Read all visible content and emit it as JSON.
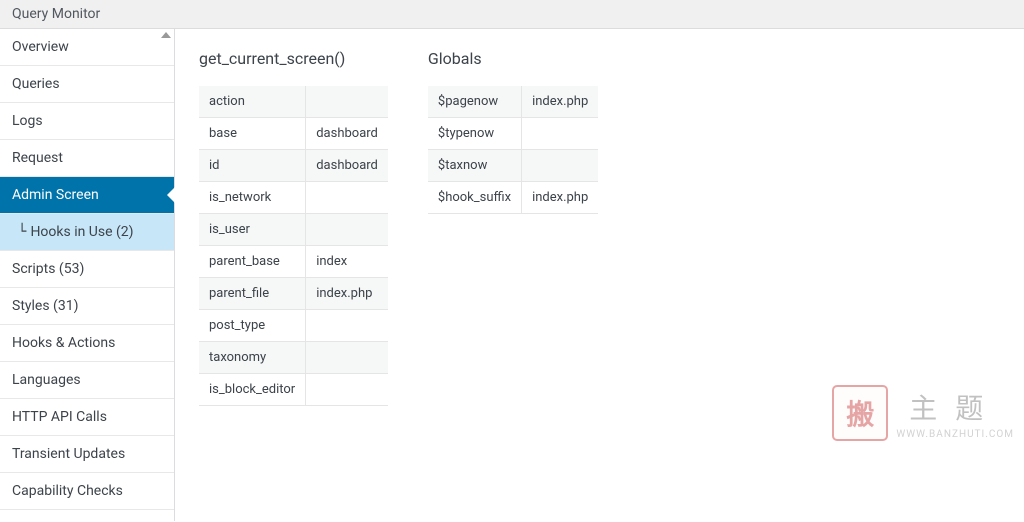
{
  "header": {
    "title": "Query Monitor"
  },
  "sidebar": {
    "items": [
      {
        "label": "Overview"
      },
      {
        "label": "Queries"
      },
      {
        "label": "Logs"
      },
      {
        "label": "Request"
      },
      {
        "label": "Admin Screen"
      },
      {
        "label": "Hooks in Use (2)"
      },
      {
        "label": "Scripts (53)"
      },
      {
        "label": "Styles (31)"
      },
      {
        "label": "Hooks & Actions"
      },
      {
        "label": "Languages"
      },
      {
        "label": "HTTP API Calls"
      },
      {
        "label": "Transient Updates"
      },
      {
        "label": "Capability Checks"
      }
    ]
  },
  "screen_section": {
    "heading": "get_current_screen()",
    "rows": [
      {
        "k": "action",
        "v": ""
      },
      {
        "k": "base",
        "v": "dashboard"
      },
      {
        "k": "id",
        "v": "dashboard"
      },
      {
        "k": "is_network",
        "v": ""
      },
      {
        "k": "is_user",
        "v": ""
      },
      {
        "k": "parent_base",
        "v": "index"
      },
      {
        "k": "parent_file",
        "v": "index.php"
      },
      {
        "k": "post_type",
        "v": ""
      },
      {
        "k": "taxonomy",
        "v": ""
      },
      {
        "k": "is_block_editor",
        "v": ""
      }
    ]
  },
  "globals_section": {
    "heading": "Globals",
    "rows": [
      {
        "k": "$pagenow",
        "v": "index.php"
      },
      {
        "k": "$typenow",
        "v": ""
      },
      {
        "k": "$taxnow",
        "v": ""
      },
      {
        "k": "$hook_suffix",
        "v": "index.php"
      }
    ]
  },
  "watermark": {
    "seal": "搬",
    "text": "主题",
    "url": "WWW.BANZHUTI.COM"
  }
}
